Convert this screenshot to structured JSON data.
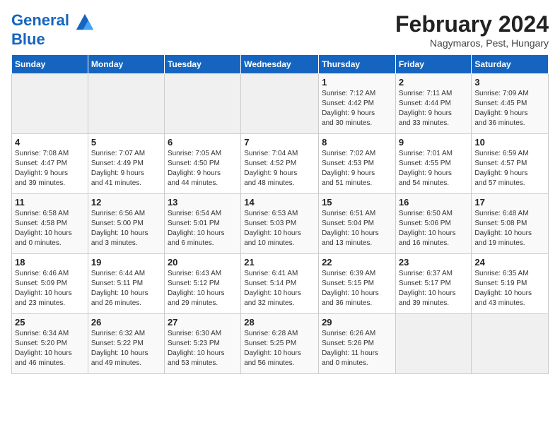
{
  "header": {
    "logo_line1": "General",
    "logo_line2": "Blue",
    "month_year": "February 2024",
    "location": "Nagymaros, Pest, Hungary"
  },
  "days_of_week": [
    "Sunday",
    "Monday",
    "Tuesday",
    "Wednesday",
    "Thursday",
    "Friday",
    "Saturday"
  ],
  "weeks": [
    [
      {
        "day": "",
        "info": ""
      },
      {
        "day": "",
        "info": ""
      },
      {
        "day": "",
        "info": ""
      },
      {
        "day": "",
        "info": ""
      },
      {
        "day": "1",
        "info": "Sunrise: 7:12 AM\nSunset: 4:42 PM\nDaylight: 9 hours\nand 30 minutes."
      },
      {
        "day": "2",
        "info": "Sunrise: 7:11 AM\nSunset: 4:44 PM\nDaylight: 9 hours\nand 33 minutes."
      },
      {
        "day": "3",
        "info": "Sunrise: 7:09 AM\nSunset: 4:45 PM\nDaylight: 9 hours\nand 36 minutes."
      }
    ],
    [
      {
        "day": "4",
        "info": "Sunrise: 7:08 AM\nSunset: 4:47 PM\nDaylight: 9 hours\nand 39 minutes."
      },
      {
        "day": "5",
        "info": "Sunrise: 7:07 AM\nSunset: 4:49 PM\nDaylight: 9 hours\nand 41 minutes."
      },
      {
        "day": "6",
        "info": "Sunrise: 7:05 AM\nSunset: 4:50 PM\nDaylight: 9 hours\nand 44 minutes."
      },
      {
        "day": "7",
        "info": "Sunrise: 7:04 AM\nSunset: 4:52 PM\nDaylight: 9 hours\nand 48 minutes."
      },
      {
        "day": "8",
        "info": "Sunrise: 7:02 AM\nSunset: 4:53 PM\nDaylight: 9 hours\nand 51 minutes."
      },
      {
        "day": "9",
        "info": "Sunrise: 7:01 AM\nSunset: 4:55 PM\nDaylight: 9 hours\nand 54 minutes."
      },
      {
        "day": "10",
        "info": "Sunrise: 6:59 AM\nSunset: 4:57 PM\nDaylight: 9 hours\nand 57 minutes."
      }
    ],
    [
      {
        "day": "11",
        "info": "Sunrise: 6:58 AM\nSunset: 4:58 PM\nDaylight: 10 hours\nand 0 minutes."
      },
      {
        "day": "12",
        "info": "Sunrise: 6:56 AM\nSunset: 5:00 PM\nDaylight: 10 hours\nand 3 minutes."
      },
      {
        "day": "13",
        "info": "Sunrise: 6:54 AM\nSunset: 5:01 PM\nDaylight: 10 hours\nand 6 minutes."
      },
      {
        "day": "14",
        "info": "Sunrise: 6:53 AM\nSunset: 5:03 PM\nDaylight: 10 hours\nand 10 minutes."
      },
      {
        "day": "15",
        "info": "Sunrise: 6:51 AM\nSunset: 5:04 PM\nDaylight: 10 hours\nand 13 minutes."
      },
      {
        "day": "16",
        "info": "Sunrise: 6:50 AM\nSunset: 5:06 PM\nDaylight: 10 hours\nand 16 minutes."
      },
      {
        "day": "17",
        "info": "Sunrise: 6:48 AM\nSunset: 5:08 PM\nDaylight: 10 hours\nand 19 minutes."
      }
    ],
    [
      {
        "day": "18",
        "info": "Sunrise: 6:46 AM\nSunset: 5:09 PM\nDaylight: 10 hours\nand 23 minutes."
      },
      {
        "day": "19",
        "info": "Sunrise: 6:44 AM\nSunset: 5:11 PM\nDaylight: 10 hours\nand 26 minutes."
      },
      {
        "day": "20",
        "info": "Sunrise: 6:43 AM\nSunset: 5:12 PM\nDaylight: 10 hours\nand 29 minutes."
      },
      {
        "day": "21",
        "info": "Sunrise: 6:41 AM\nSunset: 5:14 PM\nDaylight: 10 hours\nand 32 minutes."
      },
      {
        "day": "22",
        "info": "Sunrise: 6:39 AM\nSunset: 5:15 PM\nDaylight: 10 hours\nand 36 minutes."
      },
      {
        "day": "23",
        "info": "Sunrise: 6:37 AM\nSunset: 5:17 PM\nDaylight: 10 hours\nand 39 minutes."
      },
      {
        "day": "24",
        "info": "Sunrise: 6:35 AM\nSunset: 5:19 PM\nDaylight: 10 hours\nand 43 minutes."
      }
    ],
    [
      {
        "day": "25",
        "info": "Sunrise: 6:34 AM\nSunset: 5:20 PM\nDaylight: 10 hours\nand 46 minutes."
      },
      {
        "day": "26",
        "info": "Sunrise: 6:32 AM\nSunset: 5:22 PM\nDaylight: 10 hours\nand 49 minutes."
      },
      {
        "day": "27",
        "info": "Sunrise: 6:30 AM\nSunset: 5:23 PM\nDaylight: 10 hours\nand 53 minutes."
      },
      {
        "day": "28",
        "info": "Sunrise: 6:28 AM\nSunset: 5:25 PM\nDaylight: 10 hours\nand 56 minutes."
      },
      {
        "day": "29",
        "info": "Sunrise: 6:26 AM\nSunset: 5:26 PM\nDaylight: 11 hours\nand 0 minutes."
      },
      {
        "day": "",
        "info": ""
      },
      {
        "day": "",
        "info": ""
      }
    ]
  ]
}
